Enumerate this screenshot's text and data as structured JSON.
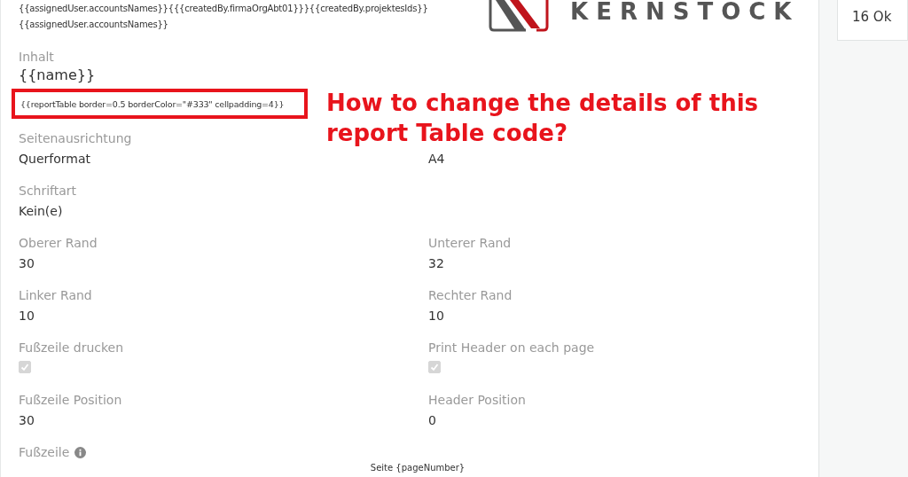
{
  "template_lines": [
    "{{assignedUser.accountsNames}}{{{createdBy.firmaOrgAbt01}}}{{createdBy.projektesIds}}",
    "{{assignedUser.accountsNames}}"
  ],
  "logo": {
    "text": "KERNSTOCK"
  },
  "content": {
    "label": "Inhalt",
    "value": "{{name}}"
  },
  "report_table_code": "{{reportTable border=0.5 borderColor=\"#333\" cellpadding=4}}",
  "annotation": "How to change the details of this report Table code?",
  "fields": [
    {
      "kind": "text",
      "label": "Seitenausrichtung",
      "value": "Querformat"
    },
    {
      "kind": "text",
      "value": "A4"
    },
    {
      "kind": "text",
      "label": "Schriftart",
      "value": "Kein(e)"
    },
    {
      "kind": "empty"
    },
    {
      "kind": "text",
      "label": "Oberer Rand",
      "value": "30"
    },
    {
      "kind": "text",
      "label": "Unterer Rand",
      "value": "32"
    },
    {
      "kind": "text",
      "label": "Linker Rand",
      "value": "10"
    },
    {
      "kind": "text",
      "label": "Rechter Rand",
      "value": "10"
    },
    {
      "kind": "checkbox",
      "label": "Fußzeile drucken",
      "checked": true,
      "disabled": true
    },
    {
      "kind": "checkbox",
      "label": "Print Header on each page",
      "checked": true,
      "disabled": true
    },
    {
      "kind": "text",
      "label": "Fußzeile Position",
      "value": "30"
    },
    {
      "kind": "text",
      "label": "Header Position",
      "value": "0"
    }
  ],
  "footer": {
    "label": "Fußzeile",
    "preview": "Seite {pageNumber}"
  },
  "side_card": {
    "value": "16 Ok"
  }
}
